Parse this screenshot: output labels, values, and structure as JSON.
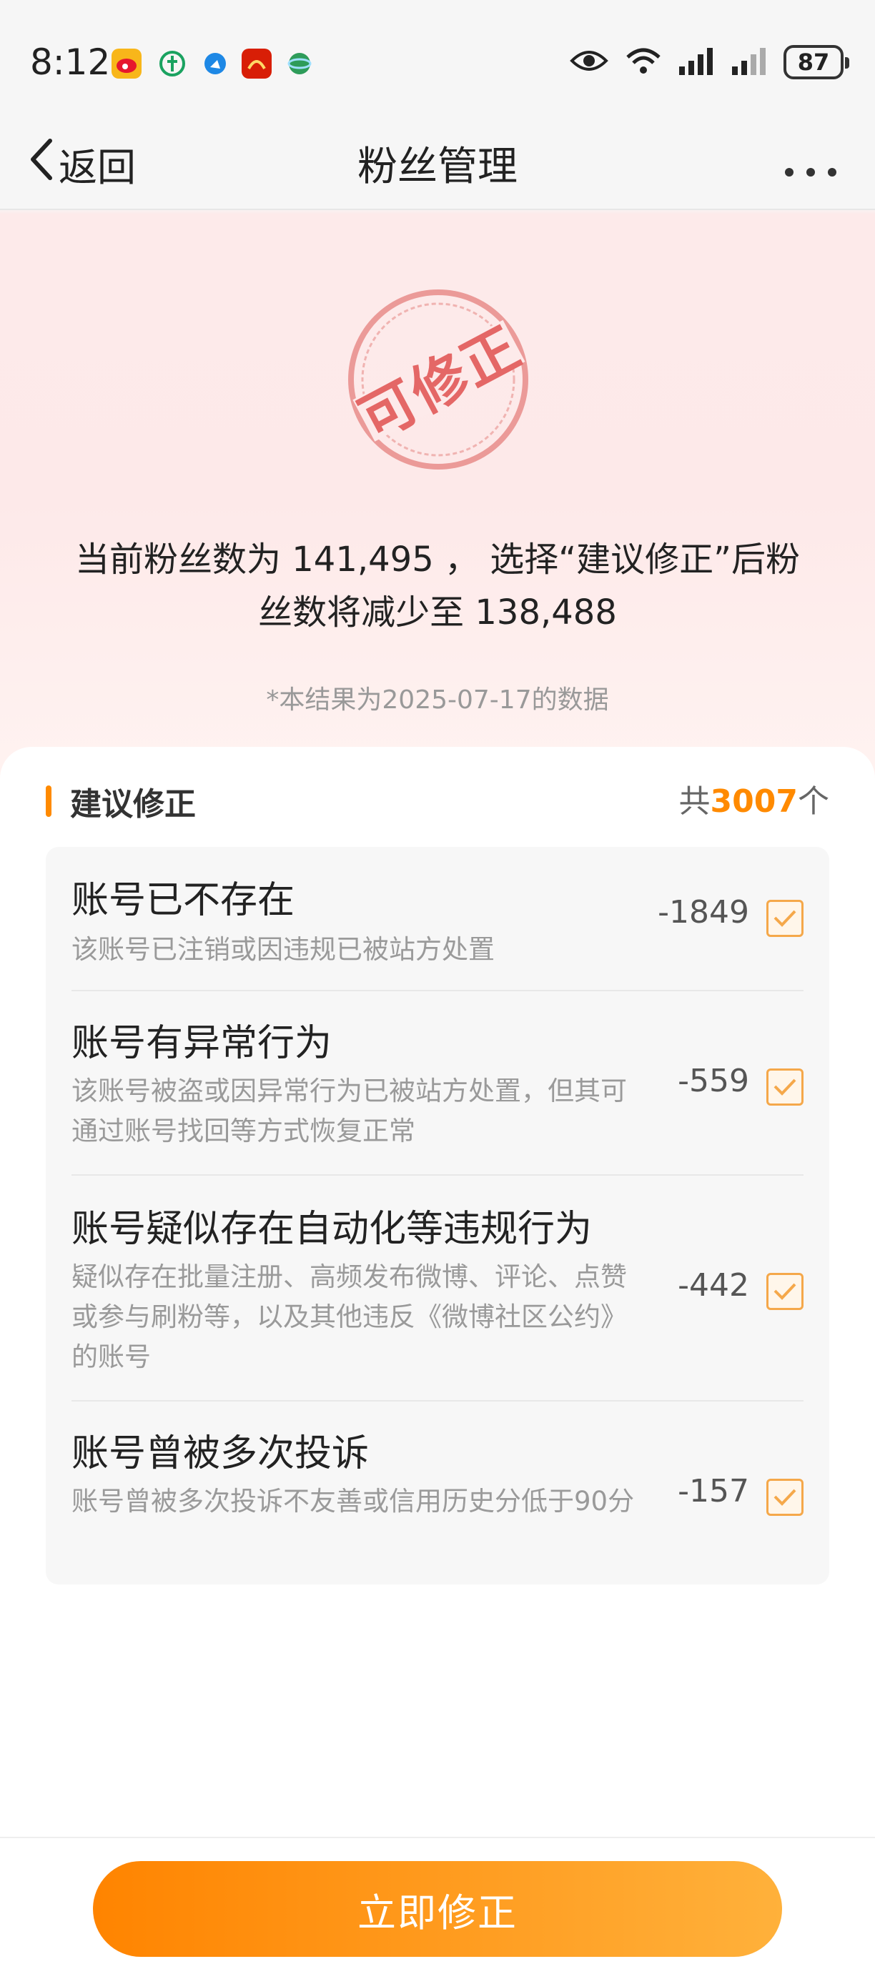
{
  "status_bar": {
    "time": "8:12",
    "battery": "87"
  },
  "nav": {
    "back_label": "返回",
    "title": "粉丝管理"
  },
  "stamp": {
    "text": "可修正"
  },
  "summary": {
    "line1": "当前粉丝数为 141,495 ， 选择“建议修正”后粉",
    "line2": "丝数将减少至 138,488",
    "note": "*本结果为2025-07-17的数据"
  },
  "section": {
    "title": "建议修正",
    "total_prefix": "共",
    "total_count": "3007",
    "total_suffix": "个"
  },
  "items": [
    {
      "title": "账号已不存在",
      "desc": "该账号已注销或因违规已被站方处置",
      "count": "-1849",
      "checked": true
    },
    {
      "title": "账号有异常行为",
      "desc": "该账号被盗或因异常行为已被站方处置，但其可通过账号找回等方式恢复正常",
      "count": "-559",
      "checked": true
    },
    {
      "title": "账号疑似存在自动化等违规行为",
      "desc": "疑似存在批量注册、高频发布微博、评论、点赞或参与刷粉等，以及其他违反《微博社区公约》的账号",
      "count": "-442",
      "checked": true
    },
    {
      "title": "账号曾被多次投诉",
      "desc": "账号曾被多次投诉不友善或信用历史分低于90分",
      "count": "-157",
      "checked": true
    }
  ],
  "action": {
    "fix_label": "立即修正"
  },
  "colors": {
    "accent": "#ff8a00",
    "stamp": "#e46766",
    "checkbox_border": "#f5a84a"
  }
}
